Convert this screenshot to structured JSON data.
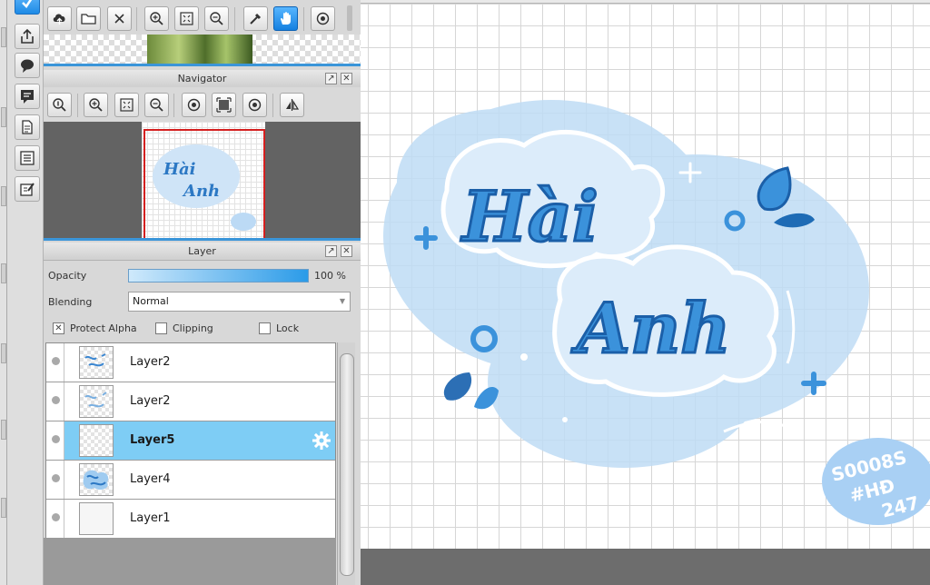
{
  "navigator": {
    "title": "Navigator"
  },
  "layer_panel": {
    "title": "Layer",
    "opacity_label": "Opacity",
    "opacity_value": "100 %",
    "opacity_fraction": 1.0,
    "blending_label": "Blending",
    "blending_value": "Normal",
    "protect_alpha_label": "Protect Alpha",
    "protect_alpha_checked": true,
    "clipping_label": "Clipping",
    "clipping_checked": false,
    "lock_label": "Lock",
    "lock_checked": false,
    "layers": [
      {
        "name": "Layer2",
        "selected": false
      },
      {
        "name": "Layer2",
        "selected": false
      },
      {
        "name": "Layer5",
        "selected": true
      },
      {
        "name": "Layer4",
        "selected": false
      },
      {
        "name": "Layer1",
        "selected": false
      }
    ]
  },
  "artwork": {
    "line1": "Hài",
    "line2": "Anh",
    "sticker_line1": "S0008S",
    "sticker_line2": "#HĐ",
    "sticker_line3": "247"
  },
  "colors": {
    "accent_blue": "#2a93e6",
    "selected_layer": "#7ecdf5",
    "nav_frame": "#d41f1f",
    "paint_light_blue": "#bfdcf5"
  },
  "icons": {
    "cmd_bar": [
      "brush-select-icon",
      "export-icon",
      "speech-bubble-icon",
      "comment-icon",
      "document-icon",
      "list-icon",
      "edit-board-icon"
    ],
    "top_toolbar": [
      "upload-cloud-icon",
      "folder-icon",
      "close-icon",
      "zoom-in-icon",
      "fit-screen-icon",
      "zoom-out-icon",
      "eyedropper-icon",
      "hand-icon",
      "rotate-icon"
    ],
    "navigator_toolbar": [
      "zoom-actual-icon",
      "zoom-in-icon",
      "fit-screen-icon",
      "zoom-out-icon",
      "rotate-left-icon",
      "fullscreen-icon",
      "rotate-right-icon",
      "flip-icon"
    ]
  }
}
